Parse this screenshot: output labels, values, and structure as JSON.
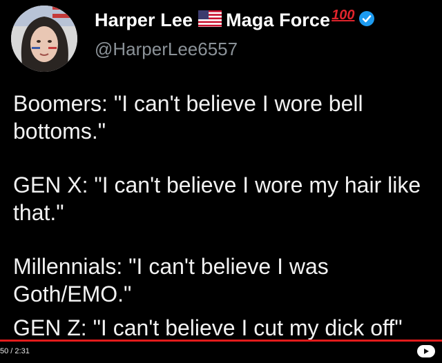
{
  "author": {
    "display_name_part1": "Harper Lee",
    "display_name_part2": "Maga Force",
    "hundred_emoji_text": "100",
    "handle": "@HarperLee6557",
    "flag_icon": "us-flag-icon",
    "verified_icon": "verified-badge-icon"
  },
  "tweet": {
    "paragraphs": [
      "Boomers: \"I can't believe I wore bell bottoms.\"",
      "GEN X: \"I can't believe I wore my hair like that.\"",
      "Millennials: \"I can't believe I was Goth/EMO.\"",
      "GEN Z: \"I can't believe I cut my dick off\""
    ]
  },
  "video": {
    "time_text": "50 / 2:31",
    "progress_color": "#e21b1b",
    "play_icon": "play-icon"
  },
  "colors": {
    "background": "#000000",
    "verified_blue": "#1d9bf0",
    "handle_gray": "#8b9298",
    "hundred_red": "#e0242c"
  }
}
